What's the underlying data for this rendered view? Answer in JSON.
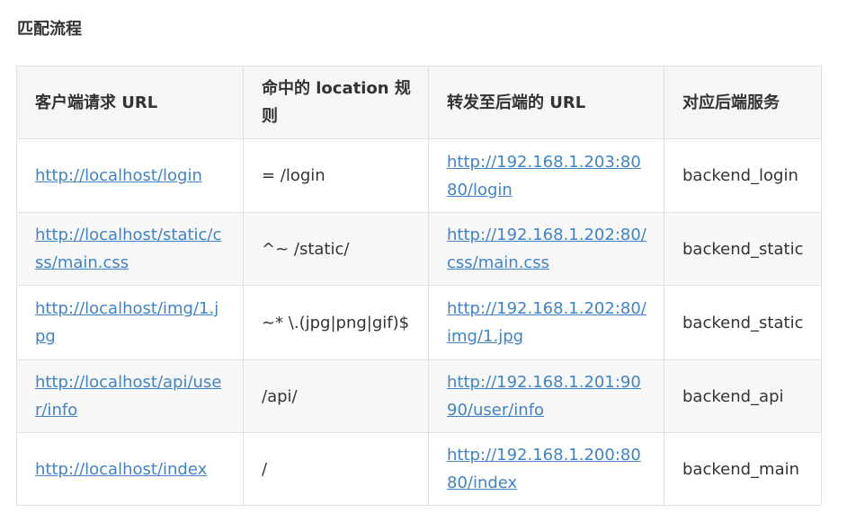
{
  "section": {
    "title": "匹配流程"
  },
  "table": {
    "headers": [
      "客户端请求 URL",
      "命中的 location 规则",
      "转发至后端的 URL",
      "对应后端服务"
    ],
    "rows": [
      {
        "client_url": "http://localhost/login",
        "location": "= /login",
        "backend_url": "http://192.168.1.203:8080/login",
        "service": "backend_login"
      },
      {
        "client_url": "http://localhost/static/css/main.css",
        "location": "^~ /static/",
        "backend_url": "http://192.168.1.202:80/css/main.css",
        "service": "backend_static"
      },
      {
        "client_url": "http://localhost/img/1.jpg",
        "location": "~* \\.(jpg|png|gif)$",
        "backend_url": "http://192.168.1.202:80/img/1.jpg",
        "service": "backend_static"
      },
      {
        "client_url": "http://localhost/api/user/info",
        "location": "/api/",
        "backend_url": "http://192.168.1.201:9090/user/info",
        "service": "backend_api"
      },
      {
        "client_url": "http://localhost/index",
        "location": "/",
        "backend_url": "http://192.168.1.200:8080/index",
        "service": "backend_main"
      }
    ]
  },
  "colors": {
    "link": "#4183c4",
    "text": "#333333",
    "border": "#dfe2e5",
    "header_bg": "#f6f6f6",
    "stripe_bg": "#f8f8f8"
  }
}
